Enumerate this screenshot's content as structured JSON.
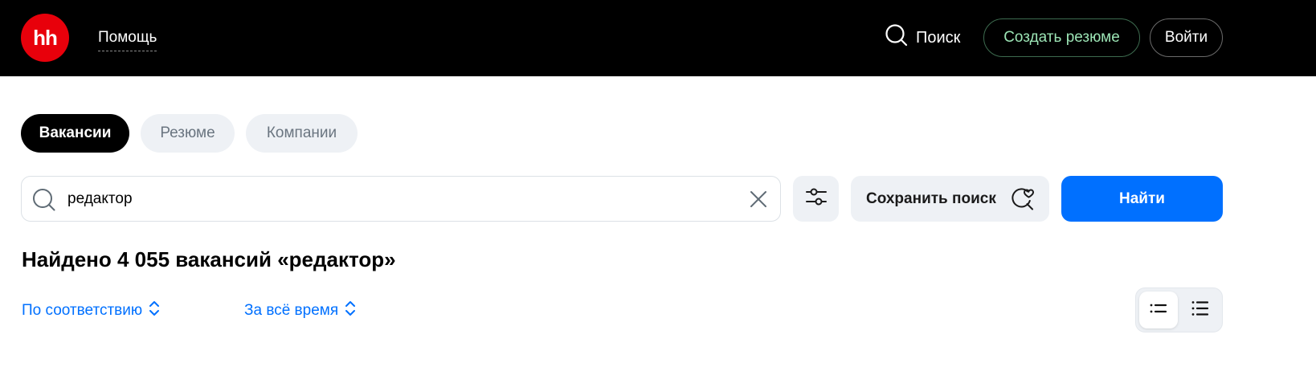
{
  "header": {
    "logo_text": "hh",
    "help_label": "Помощь",
    "search_label": "Поиск",
    "create_resume_label": "Создать резюме",
    "login_label": "Войти",
    "colors": {
      "background": "#000000",
      "logo": "#e8000b",
      "create_resume_text": "#9be3b4"
    }
  },
  "tabs": [
    {
      "label": "Вакансии",
      "active": true
    },
    {
      "label": "Резюме",
      "active": false
    },
    {
      "label": "Компании",
      "active": false
    }
  ],
  "search": {
    "value": "редактор",
    "save_label": "Сохранить поиск",
    "find_label": "Найти",
    "icons": {
      "search": "search-icon",
      "clear": "close-icon",
      "filters": "filters-icon",
      "save": "search-heart-icon"
    }
  },
  "results": {
    "title": "Найдено 4 055 вакансий «редактор»"
  },
  "sort": {
    "relevance_label": "По соответствию",
    "period_label": "За всё время"
  },
  "view_toggle": {
    "selected": "compact",
    "icons": [
      "compact-list-icon",
      "full-list-icon"
    ]
  },
  "accent_color": "#0070ff"
}
